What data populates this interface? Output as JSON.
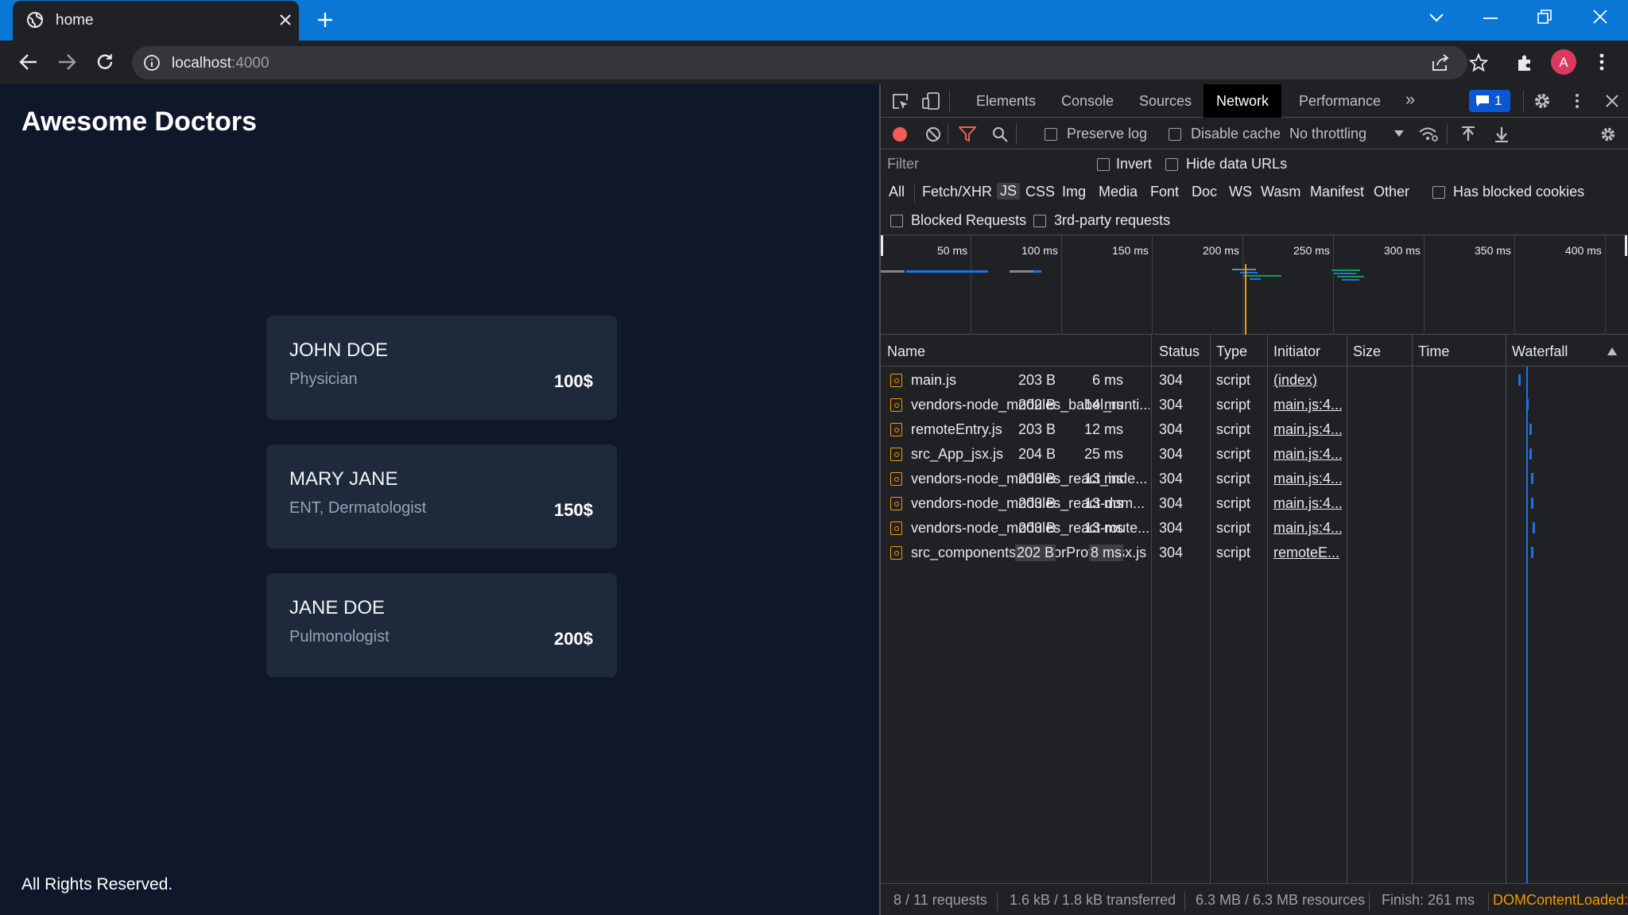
{
  "browser": {
    "tab_title": "home",
    "url_host": "localhost",
    "url_port": ":4000"
  },
  "page": {
    "title": "Awesome Doctors",
    "doctors": [
      {
        "name": "JOHN DOE",
        "specialty": "Physician",
        "price": "100$"
      },
      {
        "name": "MARY JANE",
        "specialty": "ENT, Dermatologist",
        "price": "150$"
      },
      {
        "name": "JANE DOE",
        "specialty": "Pulmonologist",
        "price": "200$"
      }
    ],
    "footer": "All Rights Reserved."
  },
  "devtools": {
    "tabs": [
      "Elements",
      "Console",
      "Sources",
      "Network",
      "Performance"
    ],
    "active_tab": "Network",
    "more_tabs": "»",
    "issues_count": "1",
    "toolbar": {
      "preserve_log": "Preserve log",
      "disable_cache": "Disable cache",
      "throttling": "No throttling"
    },
    "filter": {
      "placeholder": "Filter",
      "invert": "Invert",
      "hide_data_urls": "Hide data URLs"
    },
    "types": [
      "All",
      "Fetch/XHR",
      "JS",
      "CSS",
      "Img",
      "Media",
      "Font",
      "Doc",
      "WS",
      "Wasm",
      "Manifest",
      "Other"
    ],
    "active_type": "JS",
    "has_blocked_cookies": "Has blocked cookies",
    "blocked_requests": "Blocked Requests",
    "third_party": "3rd-party requests",
    "overview_ticks": [
      "50 ms",
      "100 ms",
      "150 ms",
      "200 ms",
      "250 ms",
      "300 ms",
      "350 ms",
      "400 ms"
    ],
    "columns": [
      "Name",
      "Status",
      "Type",
      "Initiator",
      "Size",
      "Time",
      "Waterfall"
    ],
    "requests": [
      {
        "name": "main.js",
        "status": "304",
        "type": "script",
        "initiator": "(index)",
        "size": "203 B",
        "time": "6 ms"
      },
      {
        "name": "vendors-node_modules_babel_runti...",
        "status": "304",
        "type": "script",
        "initiator": "main.js:4...",
        "size": "202 B",
        "time": "14 ms"
      },
      {
        "name": "remoteEntry.js",
        "status": "304",
        "type": "script",
        "initiator": "main.js:4...",
        "size": "203 B",
        "time": "12 ms"
      },
      {
        "name": "src_App_jsx.js",
        "status": "304",
        "type": "script",
        "initiator": "main.js:4...",
        "size": "204 B",
        "time": "25 ms"
      },
      {
        "name": "vendors-node_modules_react_inde...",
        "status": "304",
        "type": "script",
        "initiator": "main.js:4...",
        "size": "203 B",
        "time": "13 ms"
      },
      {
        "name": "vendors-node_modules_react-dom...",
        "status": "304",
        "type": "script",
        "initiator": "main.js:4...",
        "size": "203 B",
        "time": "13 ms"
      },
      {
        "name": "vendors-node_modules_react-route...",
        "status": "304",
        "type": "script",
        "initiator": "main.js:4...",
        "size": "203 B",
        "time": "13 ms"
      },
      {
        "name": "src_components_DoctorProfile_jsx.js",
        "status": "304",
        "type": "script",
        "initiator": "remoteE...",
        "size": "202 B",
        "time": "8 ms"
      }
    ],
    "status_bar": {
      "requests": "8 / 11 requests",
      "transferred": "1.6 kB / 1.8 kB transferred",
      "resources": "6.3 MB / 6.3 MB resources",
      "finish": "Finish: 261 ms",
      "dcl": "DOMContentLoaded:"
    }
  },
  "colors": {
    "page_bg": "#0f172a",
    "card_bg": "#1e293b",
    "tab_strip": "#0a77d6",
    "record": "#f25c54",
    "dcl": "#f29900"
  }
}
